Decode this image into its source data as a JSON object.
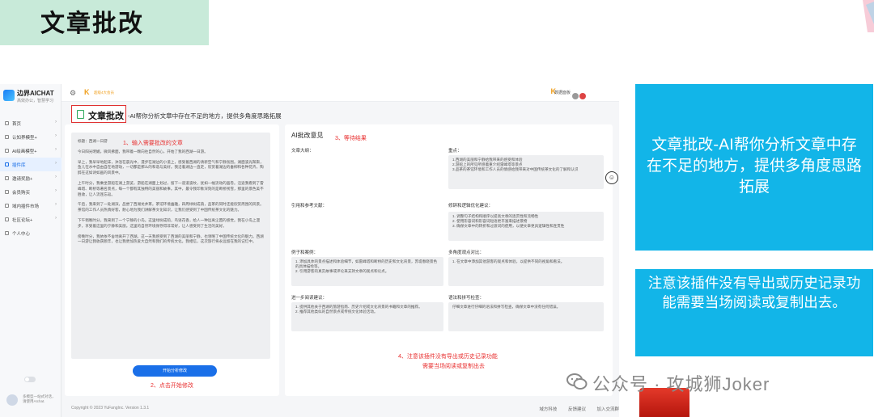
{
  "slide": {
    "title": "文章批改"
  },
  "app": {
    "brand_name": "边界AICHAT",
    "brand_sub": "高效办公，智慧学习",
    "nav": [
      {
        "label": "首页"
      },
      {
        "label": "认知界模型+"
      },
      {
        "label": "AI绘画模型+"
      },
      {
        "label": "插件库",
        "active": true
      },
      {
        "label": "邀请奖励+"
      },
      {
        "label": "会员购买"
      },
      {
        "label": "域内插件市场"
      },
      {
        "label": "社区论坛+"
      },
      {
        "label": "个人中心"
      }
    ],
    "sidebar_user_text": "多模型一站式对话，请使用AIchat.",
    "topbar": {
      "tag": "超级4大会员",
      "right_label": "数据面板"
    },
    "feature_title": "文章批改",
    "feature_desc": "-AI帮你分析文章中存在不足的地方，提供多角度思路拓展",
    "left_panel": {
      "paragraphs": [
        "标题：西湖一日游",
        "今日阳光明媚，微风拂面，我带着一颗向往自然的心，开始了我的西湖一日游。",
        "早上，我早早地起床，沐浴在晨光中，漫步在湖边的小道上，感受着西湖的清新空气和宁静氛围。湖面波光粼粼，鱼儿在水中自由自在地游动，一切都是那么的和谐与美好。我沿着湖边一直走，欣赏着湖边的垂柳和各种花卉，陶醉在这如诗如画的风景中。",
        "上午时分，我乘坐游船在湖上游览，游船在湖面上划过，留下一道道波纹，犹如一幅流动的画卷。沿途我看到了雷峰塔、断桥等著名景点，每一个都有其独特的美丽和故事。其中，最令我印象深刻的是断桥残雪，那里的景色美不胜收，让人流连忘返。",
        "午后，我来到了一处湖滨，品尝了西湖龙井茶。茶馆环境幽雅，四周绿树成荫，品茶的同时还能欣赏周围的风景。茶馆的工作人员热情好客，耐心地为我们讲解茶文化知识，让我们感受到了中国传统茶文化的魅力。",
        "下午稍晚时分，我来到了一个宁静的小岛。这里绿树成荫，鸟语花香，给人一种远离尘嚣的感觉。我在小岛上漫步，享受着这里的宁静和美丽。这里的自然环境保存得非常好，让人感受到了生活的美好。",
        "傍晚时分，我依依不舍地离开了西湖。这一天我感受到了西湖的美丽和宁静，也领略了中国传统文化的魅力。西湖一日游让我收获颇丰，也让我更加热爱大自然和我们的传统文化。我相信，这次旅行将永远留在我的记忆中。"
      ],
      "button": "开始分析修改",
      "note_input": "1、输入需要批改的文章",
      "note_click": "2、点击开始修改"
    },
    "right_panel": {
      "title": "AI批改意见",
      "note_wait": "3、等待结果",
      "note_warn_1": "4、注意该插件没有导出或历史记录功能",
      "note_warn_2": "需要当场阅读或复制出去",
      "sections": {
        "outline_label": "文章大纲：",
        "keypoints_label": "重点：",
        "keypoints_text": "1.西湖的美丽和宁静给我带来的感受和体验\n2.游船上的所见所感着重介绍雷峰塔等景点\n3.品茶的茶馆环境和工作人员的情感给我带来对中国传统茶文化的了解和认识",
        "refs_label": "引用和参考文献：",
        "polish_label": "修辞和逻辑优化建议：",
        "polish_text": "1. 调整句子结构和顺序以提高文章的连贯性和流畅性\n2. 使用形容词和形容词短语更丰富来描述景物\n3. 确保文章中的转折和过渡词的使用，以便文章更具逻辑性和连贯性",
        "examples_label": "例子和案例：",
        "examples_text": "1. 添加具体的景点描述和体验细节，如雷峰塔和断桥的历史和文化背景，苏堤春晓景色的具体描绘等。\n2. 引用游客的真实故事或评论来支持文章的观点和论点。",
        "perspective_label": "多角度观点对比：",
        "perspective_text": "1. 在文章中添加其他游客的观点和体验，以提供不同的视角和看法。",
        "further_label": "进一步阅读建议：",
        "further_text": "1. 提供其他关于西湖的旅游指南、历史介绍或文化背景的书籍和文章的推荐。\n2. 推荐其他类似的自然景点或传统文化体验活动。",
        "grammar_label": "语法和拼写检查：",
        "grammar_text": "仔细文章进行仔细的语法和拼写检查，确保文章中没有任何错误。"
      }
    },
    "footer": {
      "copyright": "Copyright © 2023 YuFangInc. Version 1.3.1",
      "links": [
        "域方科技",
        "反馈建议",
        "加入交流群"
      ]
    }
  },
  "callouts": {
    "box1": "文章批改-AI帮你分析文章中存在不足的地方，提供多角度思路拓展",
    "box2": "注意该插件没有导出或历史记录功能需要当场阅读或复制出去。"
  },
  "watermark": {
    "text": "公众号 · 攻城狮Joker"
  },
  "colors": {
    "accent_blue": "#1a6fe8",
    "callout_bg": "#12b5e8",
    "note_red": "#e83030",
    "title_bg": "#c8ead9"
  }
}
